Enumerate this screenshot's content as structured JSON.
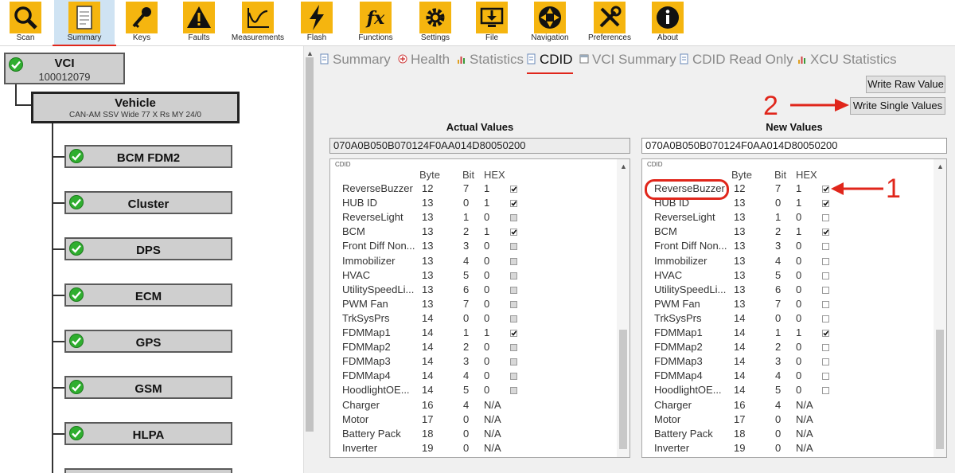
{
  "toolbar": {
    "items": [
      {
        "label": "Scan",
        "icon": "magnifier-icon"
      },
      {
        "label": "Summary",
        "icon": "document-icon",
        "active": true
      },
      {
        "label": "Keys",
        "icon": "key-icon"
      },
      {
        "label": "Faults",
        "icon": "warning-icon"
      },
      {
        "label": "Measurements",
        "icon": "graph-icon"
      },
      {
        "label": "Flash",
        "icon": "lightning-icon"
      },
      {
        "label": "Functions",
        "icon": "function-icon"
      },
      {
        "label": "Settings",
        "icon": "gear-icon"
      },
      {
        "label": "File",
        "icon": "monitor-download-icon"
      },
      {
        "label": "Navigation",
        "icon": "navigation-arrows-icon"
      },
      {
        "label": "Preferences",
        "icon": "tools-icon"
      },
      {
        "label": "About",
        "icon": "info-icon"
      }
    ]
  },
  "tree": {
    "root": {
      "title": "VCI",
      "subtitle": "100012079"
    },
    "vehicle": {
      "title": "Vehicle",
      "subtitle": "CAN-AM SSV Wide 77 X Rs MY 24/0"
    },
    "modules": [
      "BCM FDM2",
      "Cluster",
      "DPS",
      "ECM",
      "GPS",
      "GSM",
      "HLPA"
    ]
  },
  "tabs": [
    {
      "label": "Summary",
      "icon": "document-icon"
    },
    {
      "label": "Health",
      "icon": "health-cross-icon"
    },
    {
      "label": "Statistics",
      "icon": "bar-chart-icon"
    },
    {
      "label": "CDID",
      "icon": "document-icon",
      "active": true
    },
    {
      "label": "VCI Summary",
      "icon": "window-icon"
    },
    {
      "label": "CDID Read Only",
      "icon": "document-icon"
    },
    {
      "label": "XCU Statistics",
      "icon": "bar-chart-icon"
    }
  ],
  "buttons": {
    "write_raw": "Write Raw Value",
    "write_single": "Write Single Values"
  },
  "annotations": {
    "one": "1",
    "two": "2"
  },
  "colors": {
    "accent_yellow": "#f5b50f",
    "status_green": "#2fae2f",
    "annotation_red": "#e0261b",
    "active_tab_bg": "#cfe3f3"
  },
  "actual": {
    "title": "Actual Values",
    "hex": "070A0B050B070124F0AA014D80050200",
    "group": "CDID"
  },
  "new": {
    "title": "New Values",
    "hex": "070A0B050B070124F0AA014D80050200",
    "group": "CDID"
  },
  "columns": {
    "byte": "Byte",
    "bit": "Bit",
    "hex": "HEX"
  },
  "rows": [
    {
      "name": "ReverseBuzzer",
      "byte": "12",
      "bit": "7",
      "hex": "1",
      "checked": true
    },
    {
      "name": "HUB ID",
      "byte": "13",
      "bit": "0",
      "hex": "1",
      "checked": true
    },
    {
      "name": "ReverseLight",
      "byte": "13",
      "bit": "1",
      "hex": "0",
      "checked": false
    },
    {
      "name": "BCM",
      "byte": "13",
      "bit": "2",
      "hex": "1",
      "checked": true
    },
    {
      "name": "Front Diff Non...",
      "byte": "13",
      "bit": "3",
      "hex": "0",
      "checked": false
    },
    {
      "name": "Immobilizer",
      "byte": "13",
      "bit": "4",
      "hex": "0",
      "checked": false
    },
    {
      "name": "HVAC",
      "byte": "13",
      "bit": "5",
      "hex": "0",
      "checked": false
    },
    {
      "name": "UtilitySpeedLi...",
      "byte": "13",
      "bit": "6",
      "hex": "0",
      "checked": false
    },
    {
      "name": "PWM Fan",
      "byte": "13",
      "bit": "7",
      "hex": "0",
      "checked": false
    },
    {
      "name": "TrkSysPrs",
      "byte": "14",
      "bit": "0",
      "hex": "0",
      "checked": false
    },
    {
      "name": "FDMMap1",
      "byte": "14",
      "bit": "1",
      "hex": "1",
      "checked": true
    },
    {
      "name": "FDMMap2",
      "byte": "14",
      "bit": "2",
      "hex": "0",
      "checked": false
    },
    {
      "name": "FDMMap3",
      "byte": "14",
      "bit": "3",
      "hex": "0",
      "checked": false
    },
    {
      "name": "FDMMap4",
      "byte": "14",
      "bit": "4",
      "hex": "0",
      "checked": false
    },
    {
      "name": "HoodlightOE...",
      "byte": "14",
      "bit": "5",
      "hex": "0",
      "checked": false
    },
    {
      "name": "Charger",
      "byte": "16",
      "bit": "4",
      "hex": "N/A",
      "checked": null
    },
    {
      "name": "Motor",
      "byte": "17",
      "bit": "0",
      "hex": "N/A",
      "checked": null
    },
    {
      "name": "Battery Pack",
      "byte": "18",
      "bit": "0",
      "hex": "N/A",
      "checked": null
    },
    {
      "name": "Inverter",
      "byte": "19",
      "bit": "0",
      "hex": "N/A",
      "checked": null
    }
  ]
}
